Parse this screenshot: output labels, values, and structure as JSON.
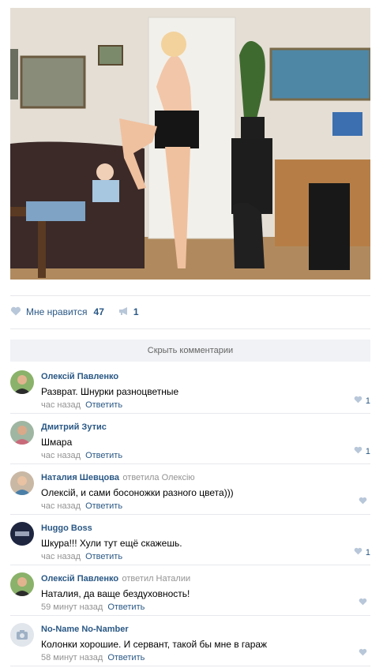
{
  "post": {
    "photo_alt": "photo",
    "like_label": "Мне нравится",
    "like_count": "47",
    "repost_count": "1"
  },
  "hide_comments_label": "Скрыть комментарии",
  "comments": [
    {
      "author": "Олексій Павленко",
      "reply_to": "",
      "text": "Разврат. Шнурки разноцветные",
      "time": "час назад",
      "reply_label": "Ответить",
      "likes": "1"
    },
    {
      "author": "Дмитрий Зутис",
      "reply_to": "",
      "text": "Шмара",
      "time": "час назад",
      "reply_label": "Ответить",
      "likes": "1"
    },
    {
      "author": "Наталия Шевцова",
      "reply_to": "ответила Олексію",
      "text": "Олексій, и сами босоножки разного цвета)))",
      "time": "час назад",
      "reply_label": "Ответить",
      "likes": ""
    },
    {
      "author": "Huggo Boss",
      "reply_to": "",
      "text": "Шкура!!! Хули тут ещё скажешь.",
      "time": "час назад",
      "reply_label": "Ответить",
      "likes": "1"
    },
    {
      "author": "Олексій Павленко",
      "reply_to": "ответил Наталии",
      "text": "Наталия, да ваще бездуховность!",
      "time": "59 минут назад",
      "reply_label": "Ответить",
      "likes": ""
    },
    {
      "author": "No-Name No-Namber",
      "reply_to": "",
      "text": "Колонки хорошие. И сервант, такой бы мне в гараж",
      "time": "58 минут назад",
      "reply_label": "Ответить",
      "likes": ""
    }
  ],
  "colors": {
    "link": "#2a5885",
    "meta": "#939393",
    "bar": "#f0f2f5",
    "heart": "#b8c7d9"
  }
}
